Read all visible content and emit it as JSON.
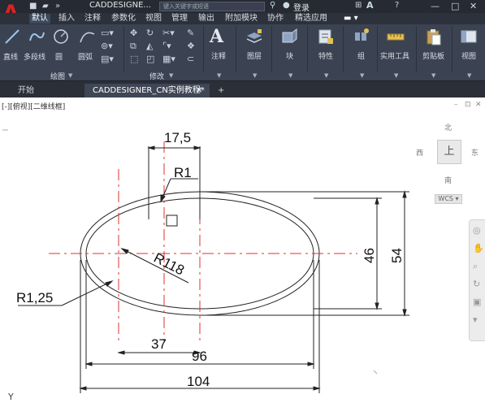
{
  "app": {
    "logo": "A",
    "title": "CADDESIGNE...",
    "search_placeholder": "键入关键字或短语",
    "login": "登录",
    "a360": "A",
    "help": "?",
    "min": "—",
    "max": "□",
    "close": "✕"
  },
  "menu": {
    "items": [
      "默认",
      "插入",
      "注释",
      "参数化",
      "视图",
      "管理",
      "输出",
      "附加模块",
      "协作",
      "精选应用"
    ]
  },
  "ribbon": {
    "tools": {
      "line": "直线",
      "polyline": "多段线",
      "circle": "圆",
      "arc": "圆弧",
      "annotation": "注释",
      "layers": "图层",
      "block": "块",
      "properties": "特性",
      "group": "组",
      "utilities": "实用工具",
      "clipboard": "剪贴板",
      "view": "视图"
    },
    "groups": {
      "draw": "绘图",
      "modify": "修改"
    }
  },
  "tabs": {
    "start": "开始",
    "document": "CADDESIGNER_CN实例教程*",
    "close": "✕",
    "add": "+"
  },
  "viewport": {
    "label": "[-][俯视][二维线框]",
    "restore": "–",
    "maximize": "⊡",
    "close": "✕"
  },
  "viewcube": {
    "north": "北",
    "south": "南",
    "east": "东",
    "west": "西",
    "top": "上",
    "wcs": "WCS ▾"
  },
  "dimensions": {
    "d17_5": "17,5",
    "r1": "R1",
    "r118": "R118",
    "r1_25": "R1,25",
    "d46": "46",
    "d54": "54",
    "d37": "37",
    "d96": "96",
    "d104": "104"
  },
  "ucs": {
    "y": "Y"
  }
}
